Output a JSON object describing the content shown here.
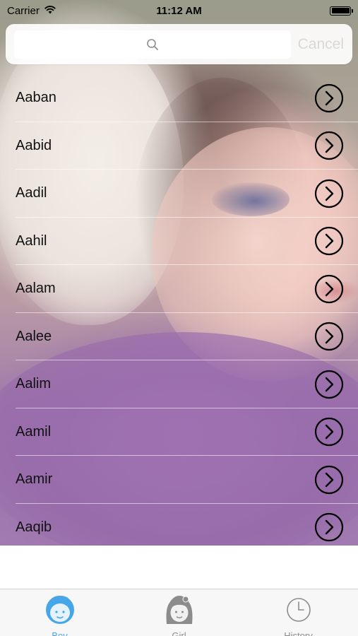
{
  "status_bar": {
    "carrier": "Carrier",
    "time": "11:12 AM",
    "icons": [
      "wifi-icon",
      "battery-icon"
    ]
  },
  "search": {
    "value": "",
    "placeholder": "",
    "cancel_label": "Cancel",
    "icon": "search-icon"
  },
  "names": [
    {
      "label": "Aaban"
    },
    {
      "label": "Aabid"
    },
    {
      "label": "Aadil"
    },
    {
      "label": "Aahil"
    },
    {
      "label": "Aalam"
    },
    {
      "label": "Aalee"
    },
    {
      "label": "Aalim"
    },
    {
      "label": "Aamil"
    },
    {
      "label": "Aamir"
    },
    {
      "label": "Aaqib"
    }
  ],
  "row_icon": "chevron-right-circle-icon",
  "tab_bar": {
    "tabs": [
      {
        "label": "Boy",
        "icon": "boy-face-icon",
        "active": true
      },
      {
        "label": "Girl",
        "icon": "girl-face-icon",
        "active": false
      },
      {
        "label": "History",
        "icon": "clock-icon",
        "active": false
      }
    ]
  },
  "colors": {
    "accent": "#47a6e8",
    "inactive": "#8c8c8c",
    "cancel": "#d8d8d8"
  }
}
